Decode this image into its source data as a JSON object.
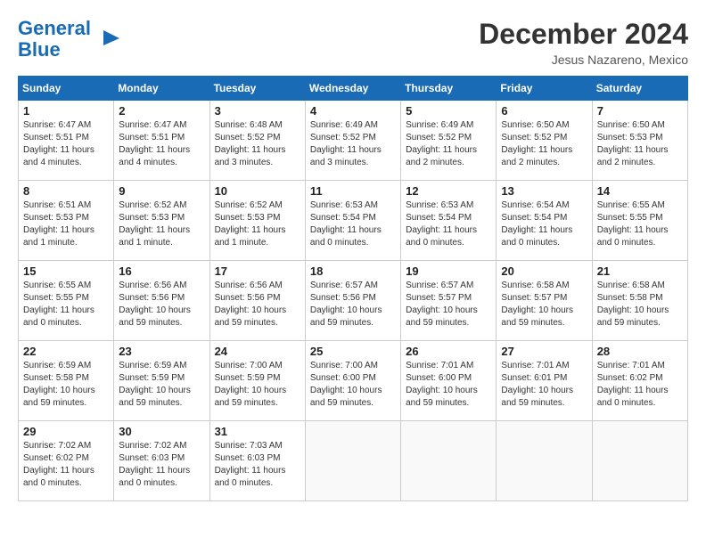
{
  "logo": {
    "line1": "General",
    "line2": "Blue"
  },
  "title": "December 2024",
  "location": "Jesus Nazareno, Mexico",
  "days_of_week": [
    "Sunday",
    "Monday",
    "Tuesday",
    "Wednesday",
    "Thursday",
    "Friday",
    "Saturday"
  ],
  "weeks": [
    [
      {
        "day": "1",
        "info": "Sunrise: 6:47 AM\nSunset: 5:51 PM\nDaylight: 11 hours and 4 minutes."
      },
      {
        "day": "2",
        "info": "Sunrise: 6:47 AM\nSunset: 5:51 PM\nDaylight: 11 hours and 4 minutes."
      },
      {
        "day": "3",
        "info": "Sunrise: 6:48 AM\nSunset: 5:52 PM\nDaylight: 11 hours and 3 minutes."
      },
      {
        "day": "4",
        "info": "Sunrise: 6:49 AM\nSunset: 5:52 PM\nDaylight: 11 hours and 3 minutes."
      },
      {
        "day": "5",
        "info": "Sunrise: 6:49 AM\nSunset: 5:52 PM\nDaylight: 11 hours and 2 minutes."
      },
      {
        "day": "6",
        "info": "Sunrise: 6:50 AM\nSunset: 5:52 PM\nDaylight: 11 hours and 2 minutes."
      },
      {
        "day": "7",
        "info": "Sunrise: 6:50 AM\nSunset: 5:53 PM\nDaylight: 11 hours and 2 minutes."
      }
    ],
    [
      {
        "day": "8",
        "info": "Sunrise: 6:51 AM\nSunset: 5:53 PM\nDaylight: 11 hours and 1 minute."
      },
      {
        "day": "9",
        "info": "Sunrise: 6:52 AM\nSunset: 5:53 PM\nDaylight: 11 hours and 1 minute."
      },
      {
        "day": "10",
        "info": "Sunrise: 6:52 AM\nSunset: 5:53 PM\nDaylight: 11 hours and 1 minute."
      },
      {
        "day": "11",
        "info": "Sunrise: 6:53 AM\nSunset: 5:54 PM\nDaylight: 11 hours and 0 minutes."
      },
      {
        "day": "12",
        "info": "Sunrise: 6:53 AM\nSunset: 5:54 PM\nDaylight: 11 hours and 0 minutes."
      },
      {
        "day": "13",
        "info": "Sunrise: 6:54 AM\nSunset: 5:54 PM\nDaylight: 11 hours and 0 minutes."
      },
      {
        "day": "14",
        "info": "Sunrise: 6:55 AM\nSunset: 5:55 PM\nDaylight: 11 hours and 0 minutes."
      }
    ],
    [
      {
        "day": "15",
        "info": "Sunrise: 6:55 AM\nSunset: 5:55 PM\nDaylight: 11 hours and 0 minutes."
      },
      {
        "day": "16",
        "info": "Sunrise: 6:56 AM\nSunset: 5:56 PM\nDaylight: 10 hours and 59 minutes."
      },
      {
        "day": "17",
        "info": "Sunrise: 6:56 AM\nSunset: 5:56 PM\nDaylight: 10 hours and 59 minutes."
      },
      {
        "day": "18",
        "info": "Sunrise: 6:57 AM\nSunset: 5:56 PM\nDaylight: 10 hours and 59 minutes."
      },
      {
        "day": "19",
        "info": "Sunrise: 6:57 AM\nSunset: 5:57 PM\nDaylight: 10 hours and 59 minutes."
      },
      {
        "day": "20",
        "info": "Sunrise: 6:58 AM\nSunset: 5:57 PM\nDaylight: 10 hours and 59 minutes."
      },
      {
        "day": "21",
        "info": "Sunrise: 6:58 AM\nSunset: 5:58 PM\nDaylight: 10 hours and 59 minutes."
      }
    ],
    [
      {
        "day": "22",
        "info": "Sunrise: 6:59 AM\nSunset: 5:58 PM\nDaylight: 10 hours and 59 minutes."
      },
      {
        "day": "23",
        "info": "Sunrise: 6:59 AM\nSunset: 5:59 PM\nDaylight: 10 hours and 59 minutes."
      },
      {
        "day": "24",
        "info": "Sunrise: 7:00 AM\nSunset: 5:59 PM\nDaylight: 10 hours and 59 minutes."
      },
      {
        "day": "25",
        "info": "Sunrise: 7:00 AM\nSunset: 6:00 PM\nDaylight: 10 hours and 59 minutes."
      },
      {
        "day": "26",
        "info": "Sunrise: 7:01 AM\nSunset: 6:00 PM\nDaylight: 10 hours and 59 minutes."
      },
      {
        "day": "27",
        "info": "Sunrise: 7:01 AM\nSunset: 6:01 PM\nDaylight: 10 hours and 59 minutes."
      },
      {
        "day": "28",
        "info": "Sunrise: 7:01 AM\nSunset: 6:02 PM\nDaylight: 11 hours and 0 minutes."
      }
    ],
    [
      {
        "day": "29",
        "info": "Sunrise: 7:02 AM\nSunset: 6:02 PM\nDaylight: 11 hours and 0 minutes."
      },
      {
        "day": "30",
        "info": "Sunrise: 7:02 AM\nSunset: 6:03 PM\nDaylight: 11 hours and 0 minutes."
      },
      {
        "day": "31",
        "info": "Sunrise: 7:03 AM\nSunset: 6:03 PM\nDaylight: 11 hours and 0 minutes."
      },
      null,
      null,
      null,
      null
    ]
  ]
}
